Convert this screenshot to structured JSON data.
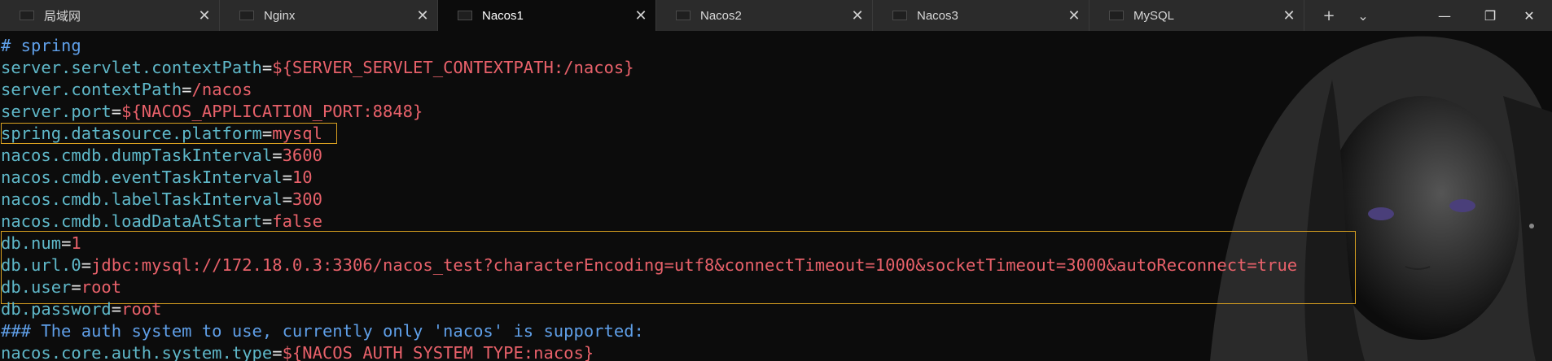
{
  "tabs": [
    {
      "label": "局域网",
      "active": false
    },
    {
      "label": "Nginx",
      "active": false
    },
    {
      "label": "Nacos1",
      "active": true
    },
    {
      "label": "Nacos2",
      "active": false
    },
    {
      "label": "Nacos3",
      "active": false
    },
    {
      "label": "MySQL",
      "active": false
    }
  ],
  "tab_controls": {
    "new_tab": "+",
    "dropdown": "⌄"
  },
  "window_controls": {
    "minimize": "—",
    "maximize": "❐",
    "close": "✕"
  },
  "terminal": {
    "lines": [
      {
        "type": "comment",
        "text": "# spring"
      },
      {
        "type": "kv",
        "key": "server.servlet.contextPath",
        "value": "${SERVER_SERVLET_CONTEXTPATH:/nacos}"
      },
      {
        "type": "kv",
        "key": "server.contextPath",
        "value": "/nacos"
      },
      {
        "type": "kv",
        "key": "server.port",
        "value": "${NACOS_APPLICATION_PORT:8848}"
      },
      {
        "type": "kv",
        "key": "spring.datasource.platform",
        "value": "mysql"
      },
      {
        "type": "kv",
        "key": "nacos.cmdb.dumpTaskInterval",
        "value": "3600"
      },
      {
        "type": "kv",
        "key": "nacos.cmdb.eventTaskInterval",
        "value": "10"
      },
      {
        "type": "kv",
        "key": "nacos.cmdb.labelTaskInterval",
        "value": "300"
      },
      {
        "type": "kv",
        "key": "nacos.cmdb.loadDataAtStart",
        "value": "false"
      },
      {
        "type": "kv",
        "key": "db.num",
        "value": "1"
      },
      {
        "type": "kv",
        "key": "db.url.0",
        "value": "jdbc:mysql://172.18.0.3:3306/nacos_test?characterEncoding=utf8&connectTimeout=1000&socketTimeout=3000&autoReconnect=true"
      },
      {
        "type": "kv",
        "key": "db.user",
        "value": "root"
      },
      {
        "type": "kv",
        "key": "db.password",
        "value": "root"
      },
      {
        "type": "comment",
        "text": "### The auth system to use, currently only 'nacos' is supported:"
      },
      {
        "type": "kv",
        "key": "nacos.core.auth.system.type",
        "value": "${NACOS_AUTH_SYSTEM_TYPE:nacos}"
      }
    ],
    "equals": "="
  },
  "colors": {
    "key": "#5fb8c9",
    "value": "#e8616a",
    "comment": "#5f9fe8",
    "highlight_border": "#d8a020",
    "background": "#0c0c0c",
    "tabbar": "#2b2b2b"
  }
}
